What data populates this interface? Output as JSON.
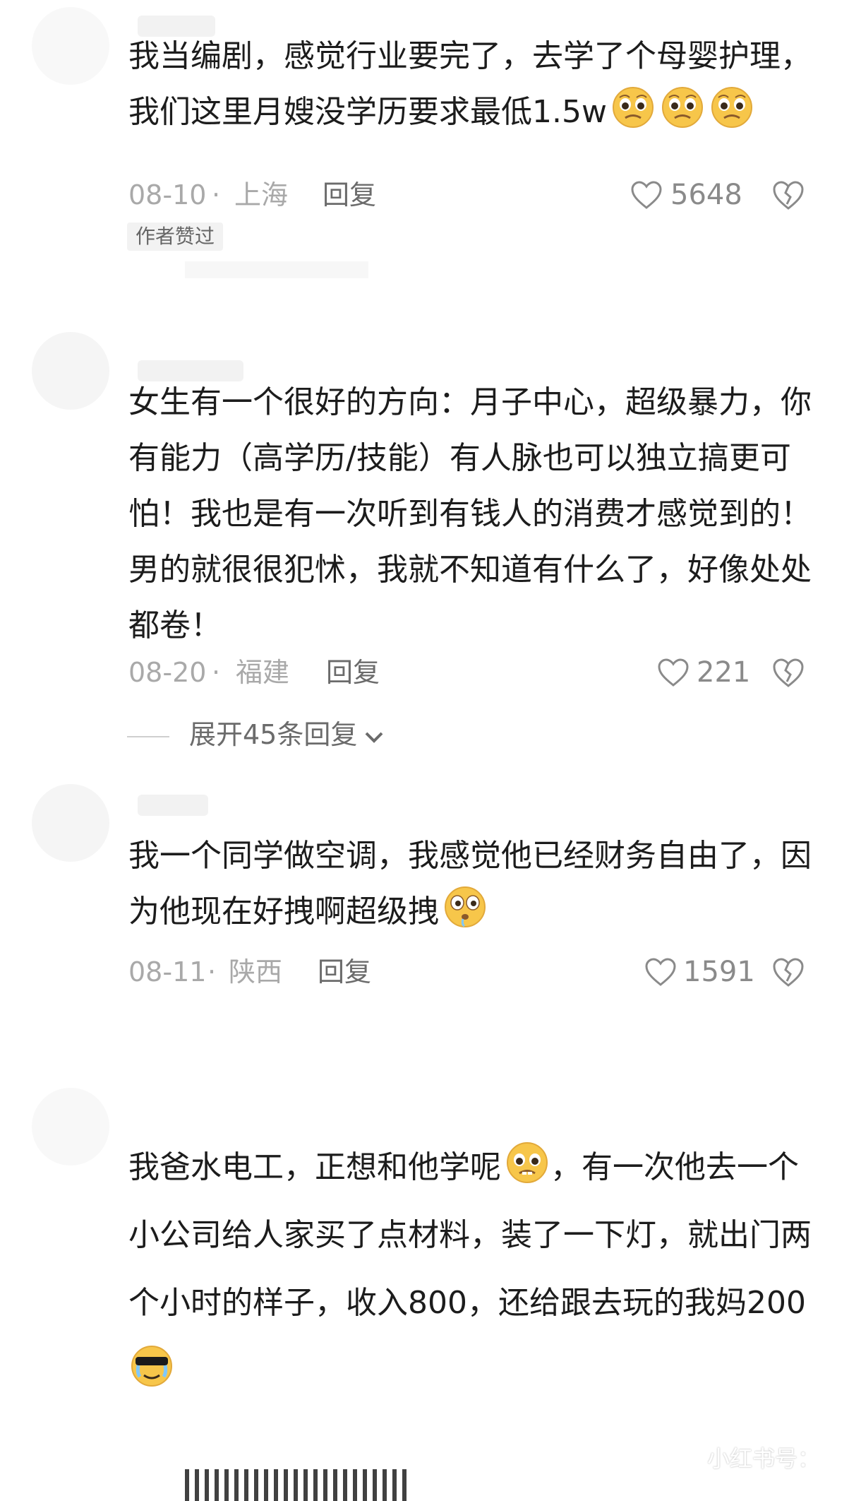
{
  "colors": {
    "text": "#1c1c1c",
    "meta": "#a9a9a9",
    "reply": "#6b6b6b",
    "badge_bg": "#f2f2f2",
    "emoji_yellow": "#f7c64a"
  },
  "comments": [
    {
      "text": "我当编剧，感觉行业要完了，去学了个母婴护理，\n我们这里月嫂没学历要求最低1.5w",
      "emojis": [
        "pleading-face-icon",
        "pleading-face-icon",
        "pleading-face-icon"
      ],
      "date": "08-10",
      "separator": "·",
      "region": "上海",
      "reply_label": "回复",
      "likes": "5648",
      "badge": "作者赞过"
    },
    {
      "text": "女生有一个很好的方向：月子中心，超级暴力，你\n有能力（高学历/技能）有人脉也可以独立搞更可\n怕！我也是有一次听到有钱人的消费才感觉到的！\n男的就很很犯怵，我就不知道有什么了，好像处处\n都卷！",
      "date": "08-20",
      "separator": "·",
      "region": "福建",
      "reply_label": "回复",
      "likes": "221",
      "expand_label": "展开45条回复"
    },
    {
      "text": "我一个同学做空调，我感觉他已经财务自由了，因\n为他现在好拽啊超级拽",
      "emojis": [
        "drooling-face-icon"
      ],
      "date": "08-11",
      "separator": "·",
      "region": "陕西",
      "reply_label": "回复",
      "likes": "1591"
    },
    {
      "text_line1_a": "我爸水电工，正想和他学呢",
      "text_line1_b": "，有一次他去一个",
      "text_rest": "小公司给人家买了点材料，装了一下灯，就出门两\n个小时的样子，收入800，还给跟去玩的我妈200",
      "emojis": [
        "pleading-face-icon",
        "sunglasses-crying-face-icon"
      ]
    }
  ],
  "watermark": "小红书号："
}
